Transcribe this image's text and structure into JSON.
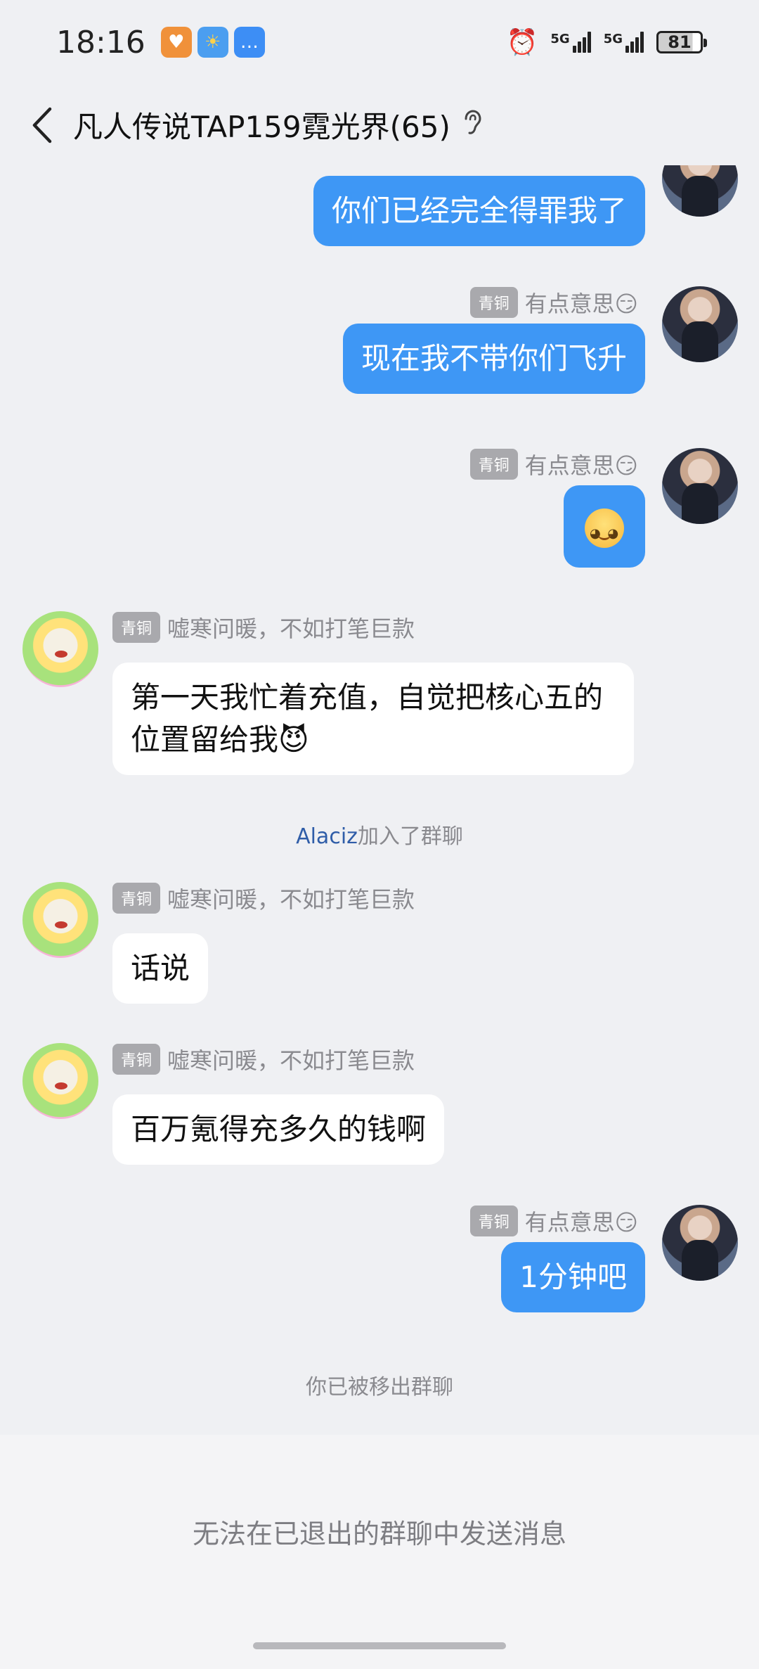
{
  "status": {
    "time": "18:16",
    "network1": "5G",
    "network2": "5G",
    "battery": "81"
  },
  "header": {
    "title": "凡人传说TAP159霓光界(65)"
  },
  "messages": [
    {
      "text": "你们已经完全得罪我了"
    },
    {
      "badge": "青铜",
      "sender": "有点意思😏",
      "text": "现在我不带你们飞升"
    },
    {
      "badge": "青铜",
      "sender": "有点意思😏"
    },
    {
      "badge": "青铜",
      "sender": "嘘寒问暖，不如打笔巨款",
      "text": "第一天我忙着充值，自觉把核心五的位置留给我😈"
    },
    {
      "badge": "青铜",
      "sender": "嘘寒问暖，不如打笔巨款",
      "text": "话说"
    },
    {
      "badge": "青铜",
      "sender": "嘘寒问暖，不如打笔巨款",
      "text": "百万氪得充多久的钱啊"
    },
    {
      "badge": "青铜",
      "sender": "有点意思😏",
      "text": "1分钟吧"
    }
  ],
  "system": {
    "join_name": "Alaciz",
    "join_suffix": "加入了群聊",
    "removed": "你已被移出群聊"
  },
  "footer": {
    "hint": "无法在已退出的群聊中发送消息"
  }
}
